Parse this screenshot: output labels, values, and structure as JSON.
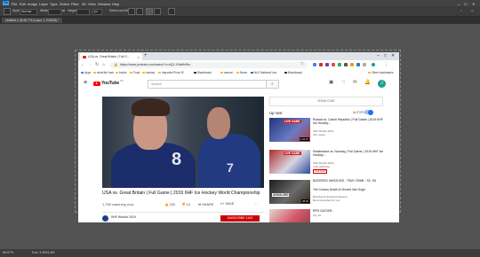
{
  "photoshop": {
    "logo": "Ps",
    "menu": [
      "File",
      "Edit",
      "Image",
      "Layer",
      "Type",
      "Select",
      "Filter",
      "3D",
      "View",
      "Window",
      "Help"
    ],
    "options": {
      "style_label": "Style:",
      "style_value": "Normal",
      "width_label": "Width:",
      "height_label": "Height:",
      "feather_label": "px",
      "select_mask_label": "Select and Mask..."
    },
    "doc_tab": "Untitled-1 @ 66.7% (Layer 1, RGB/8) *",
    "status_zoom": "66.67%",
    "status_info": "Doc: 3.3M/4.4M"
  },
  "browser": {
    "tab_title": "USA vs. Great Britain | Full G...",
    "url": "https://www.youtube.com/watch?v=bQ1-X0aWxRw",
    "bookmarks": [
      "Apps",
      "what the fuck",
      "books",
      "Food",
      "hockey",
      "Imported From IE",
      "Blackboard",
      "annual",
      "News",
      "NLE National Lea",
      "Blackboard"
    ],
    "other_bookmarks": "Other bookmarks"
  },
  "youtube": {
    "brand": "YouTube",
    "country": "CA",
    "search_placeholder": "Search",
    "avatar_letter": "J",
    "player_number": "8",
    "player_number_2": "7",
    "video_title": "USA vs. Great Britain | Full Game | 2019 IIHF Ice Hockey World Championship",
    "watching": "1,780 watching now",
    "likes": "232",
    "dislikes": "14",
    "share": "SHARE",
    "save": "SAVE",
    "more": "...",
    "channel": "IIHF Worlds 2019",
    "subscribe": "SUBSCRIBE 112K",
    "chat_label": "SHOW CHAT",
    "up_next": "Up next",
    "autoplay": "AUTOPLAY",
    "recommendations": [
      {
        "title": "Russia vs. Czech Republic | Full Game | 2019 IIHF Ice Hockey...",
        "channel": "IIHF Worlds 2019",
        "views": "47K views",
        "badge": "LIVE GAME",
        "duration": "2:34:37"
      },
      {
        "title": "Switzerland vs. Norway | Full Game | 2019 IIHF Ice Hockey...",
        "channel": "IIHF Worlds 2019",
        "views": "4.4K watching",
        "badge": "LIVE GAME",
        "live": "LIVE NOW"
      },
      {
        "title": "BUZZFEED UNSOLVED - TRUE CRIME - S3 - E6",
        "subtitle": "The Curious Death of Vincent Van Gogh",
        "channel": "BuzzFeed Unsolved Network",
        "views": "Recommended for you",
        "badge": "UNSOLVED",
        "duration": "28:02"
      },
      {
        "title": "RPS GUITAR...",
        "channel": "Top 10",
        "views": "",
        "badge": "",
        "duration": ""
      }
    ]
  }
}
